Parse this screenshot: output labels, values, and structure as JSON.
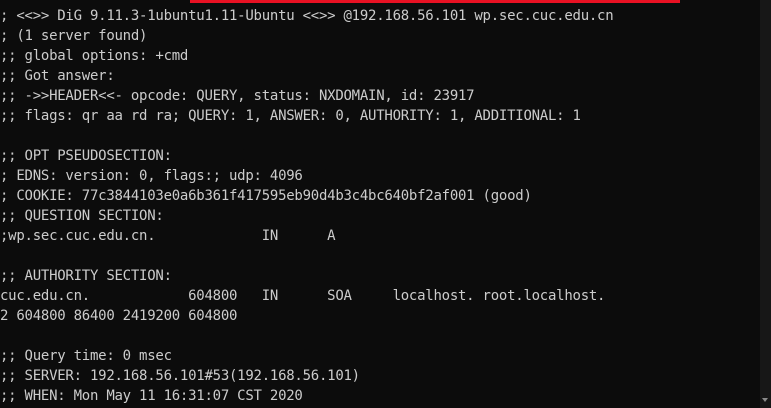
{
  "terminal": {
    "lines": [
      "; <<>> DiG 9.11.3-1ubuntu1.11-Ubuntu <<>> @192.168.56.101 wp.sec.cuc.edu.cn",
      "; (1 server found)",
      ";; global options: +cmd",
      ";; Got answer:",
      ";; ->>HEADER<<- opcode: QUERY, status: NXDOMAIN, id: 23917",
      ";; flags: qr aa rd ra; QUERY: 1, ANSWER: 0, AUTHORITY: 1, ADDITIONAL: 1",
      "",
      ";; OPT PSEUDOSECTION:",
      "; EDNS: version: 0, flags:; udp: 4096",
      "; COOKIE: 77c3844103e0a6b361f417595eb90d4b3c4bc640bf2af001 (good)",
      ";; QUESTION SECTION:",
      ";wp.sec.cuc.edu.cn.             IN      A",
      "",
      ";; AUTHORITY SECTION:",
      "cuc.edu.cn.            604800   IN      SOA     localhost. root.localhost.",
      "2 604800 86400 2419200 604800",
      "",
      ";; Query time: 0 msec",
      ";; SERVER: 192.168.56.101#53(192.168.56.101)",
      ";; WHEN: Mon May 11 16:31:07 CST 2020"
    ]
  },
  "colors": {
    "background": "#0c0c0c",
    "text": "#cccccc",
    "highlight": "#e81123"
  }
}
